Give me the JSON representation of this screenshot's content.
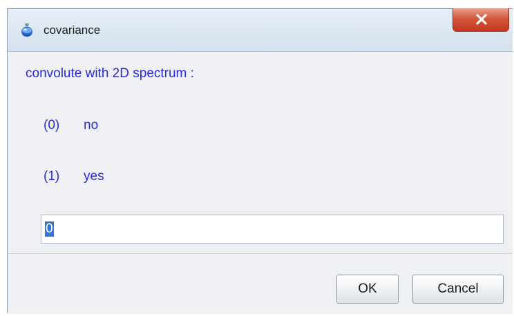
{
  "window": {
    "title": "covariance",
    "close_symbol": "X",
    "app_icon": "flask-icon"
  },
  "dialog": {
    "prompt": "convolute with 2D spectrum :",
    "options": [
      {
        "index": "(0)",
        "label": "no"
      },
      {
        "index": "(1)",
        "label": "yes"
      }
    ],
    "input_value": "0"
  },
  "buttons": {
    "ok_label": "OK",
    "cancel_label": "Cancel"
  },
  "colors": {
    "text_blue": "#2a2ad6",
    "close_red": "#c1391f",
    "selection": "#3574d4"
  }
}
